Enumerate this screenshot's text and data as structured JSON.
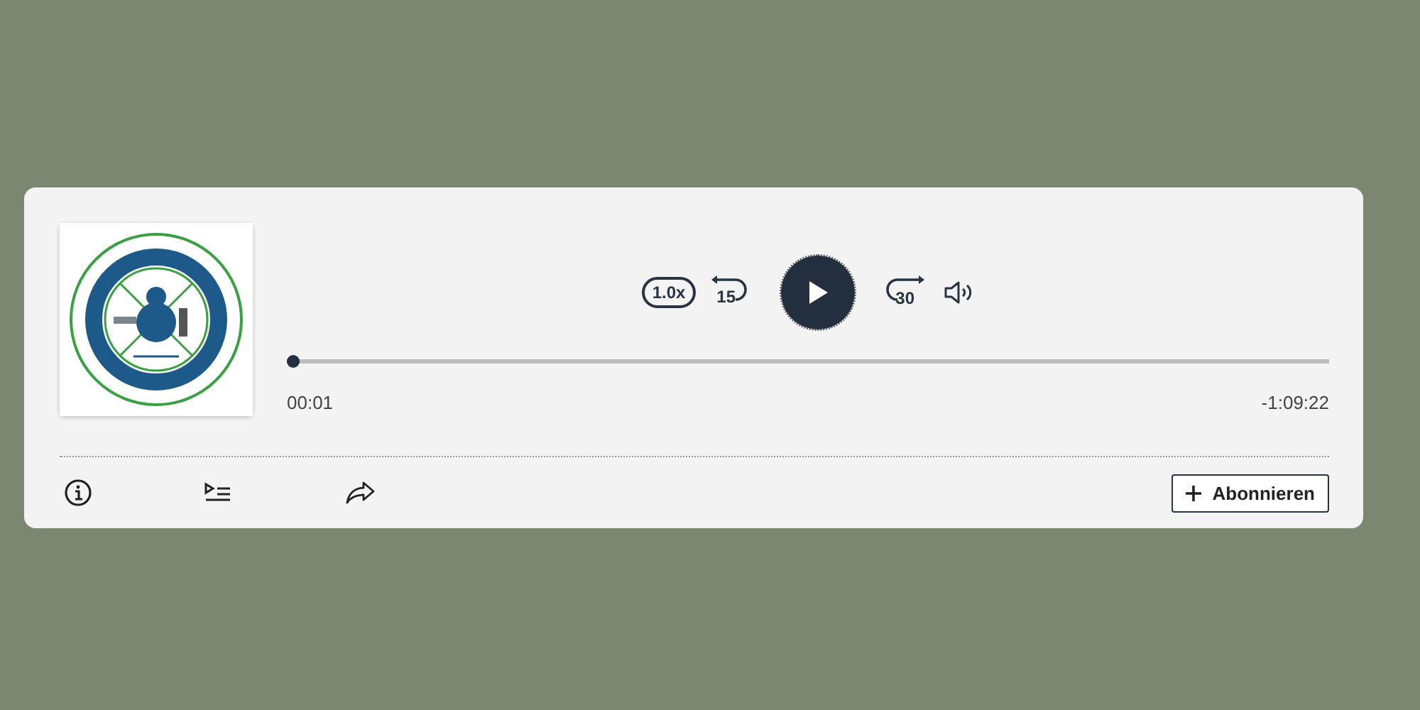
{
  "controls": {
    "speed": "1.0x",
    "skip_back": "15",
    "skip_forward": "30",
    "playing": false
  },
  "progress": {
    "level": 0.0,
    "elapsed": "00:01",
    "remaining": "-1:09:22"
  },
  "subscribe": {
    "label": "Abonnieren"
  }
}
